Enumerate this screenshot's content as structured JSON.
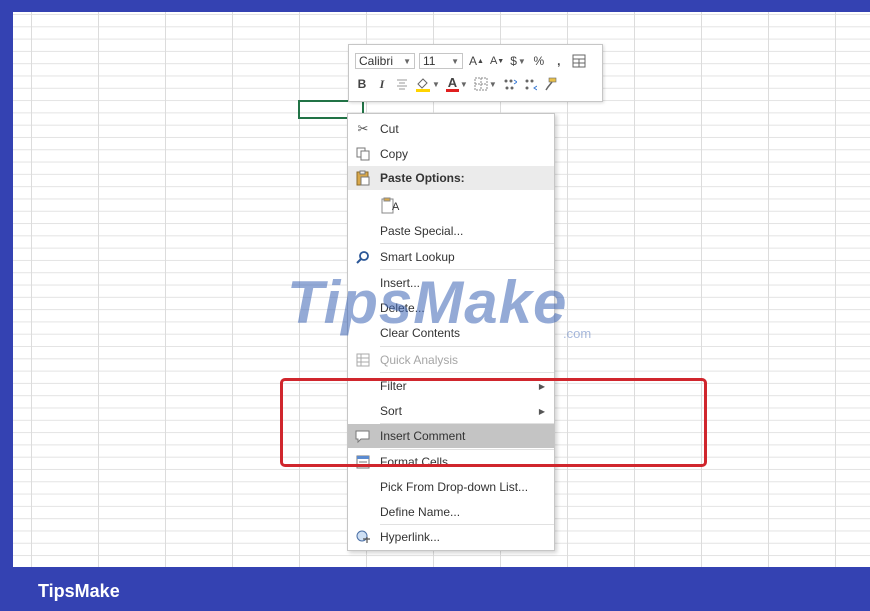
{
  "brand": {
    "name": "TipsMake"
  },
  "watermark": {
    "main": "TipsMake",
    "suffix": ".com"
  },
  "mini_toolbar": {
    "font_name": "Calibri",
    "font_size": "11",
    "grow_font": "A",
    "shrink_font": "A",
    "currency": "$",
    "percent": "%",
    "comma": ",",
    "bold": "B",
    "italic": "I",
    "font_color": "A"
  },
  "context_menu": {
    "items": [
      {
        "label": "Cut",
        "icon": "scissors-icon"
      },
      {
        "label": "Copy",
        "icon": "copy-icon"
      },
      {
        "label": "Paste Options:",
        "icon": "clipboard-icon"
      },
      {
        "label": "A",
        "icon": "paste-icon"
      },
      {
        "label": "Paste Special..."
      },
      {
        "label": "Smart Lookup",
        "icon": "search-icon"
      },
      {
        "label": "Insert..."
      },
      {
        "label": "Delete..."
      },
      {
        "label": "Clear Contents"
      },
      {
        "label": "Quick Analysis",
        "icon": "quick-analysis-icon"
      },
      {
        "label": "Filter",
        "icon": "submenu-arrow-icon"
      },
      {
        "label": "Sort",
        "icon": "submenu-arrow-icon"
      },
      {
        "label": "Insert Comment",
        "icon": "comment-icon"
      },
      {
        "label": "Format Cells...",
        "icon": "format-cells-icon"
      },
      {
        "label": "Pick From Drop-down List..."
      },
      {
        "label": "Define Name..."
      },
      {
        "label": "Hyperlink...",
        "icon": "hyperlink-icon"
      }
    ]
  },
  "colors": {
    "frame": "#3442b2",
    "highlight_box": "#d0262d",
    "active_cell": "#217346"
  }
}
